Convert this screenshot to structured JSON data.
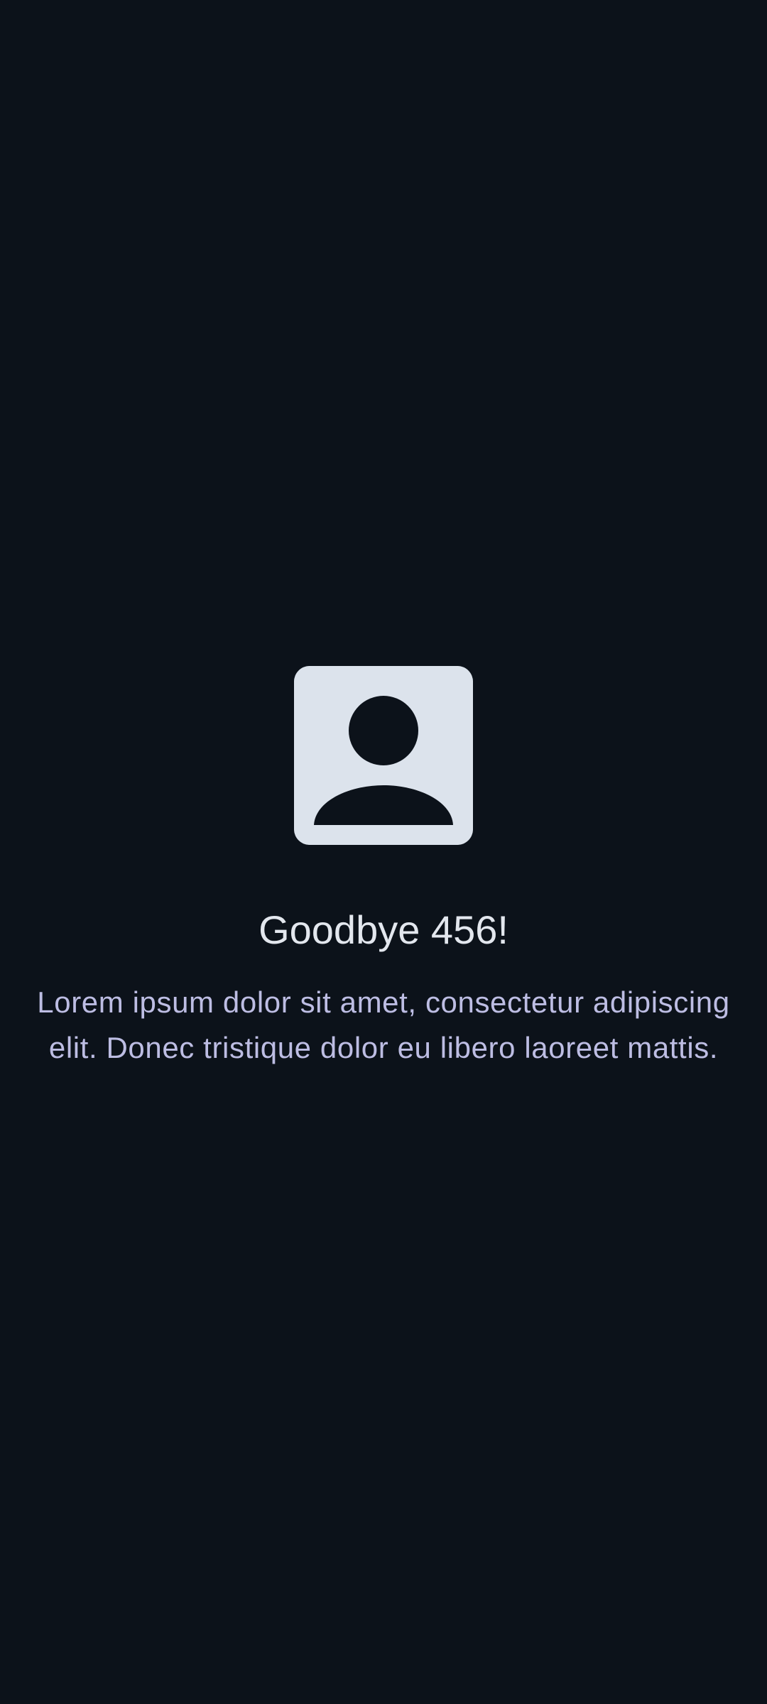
{
  "screen": {
    "avatar_icon": "person-placeholder-icon",
    "title": "Goodbye 456!",
    "body": "Lorem ipsum dolor sit amet, consectetur adipiscing elit. Donec tristique dolor eu libero laoreet mattis."
  },
  "colors": {
    "background": "#0c121a",
    "avatar_background": "#dce3ec",
    "title_text": "#e3e7ee",
    "body_text": "#bdbde3"
  }
}
